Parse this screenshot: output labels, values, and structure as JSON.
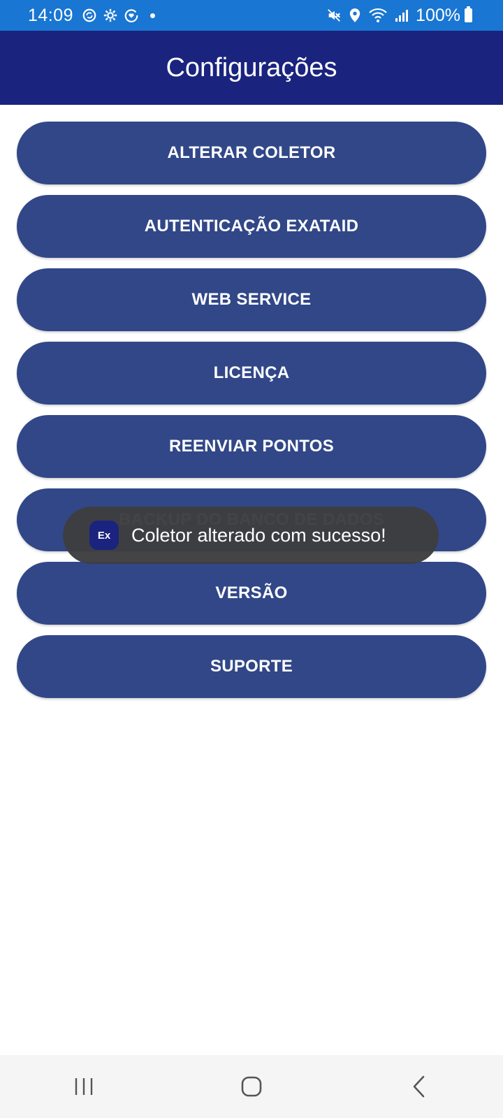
{
  "status_bar": {
    "time": "14:09",
    "left_icons": [
      "sync-icon",
      "gear-icon",
      "heart-circle-icon",
      "dot-icon"
    ],
    "right_icons": [
      "mute-icon",
      "location-icon",
      "wifi-icon",
      "signal-icon",
      "battery-icon"
    ],
    "battery": "100%"
  },
  "app_bar": {
    "title": "Configurações"
  },
  "menu": {
    "items": [
      {
        "label": "ALTERAR COLETOR"
      },
      {
        "label": "AUTENTICAÇÃO EXATAID"
      },
      {
        "label": "WEB SERVICE"
      },
      {
        "label": "LICENÇA"
      },
      {
        "label": "REENVIAR PONTOS"
      },
      {
        "label": "BACKUP DO BANCO DE DADOS"
      },
      {
        "label": "VERSÃO"
      },
      {
        "label": "SUPORTE"
      }
    ]
  },
  "toast": {
    "app_icon_text": "Ex",
    "message": "Coletor alterado com sucesso!"
  },
  "nav_bar": {
    "buttons": [
      "recent-apps-icon",
      "home-icon",
      "back-icon"
    ]
  },
  "colors": {
    "status_bar": "#1976d2",
    "app_bar": "#1a237e",
    "button": "#314788",
    "toast": "#3e3e40"
  }
}
